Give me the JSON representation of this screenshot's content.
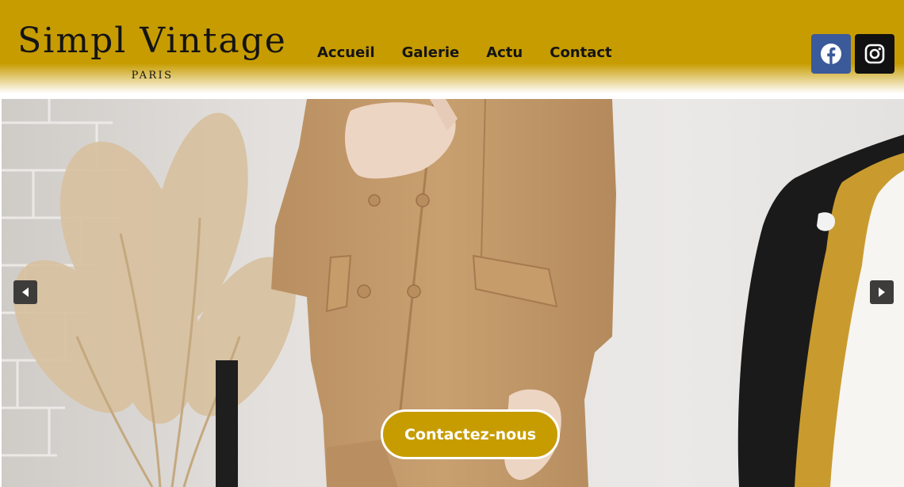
{
  "brand": {
    "title": "Simpl Vintage",
    "subtitle": "PARIS"
  },
  "nav": {
    "items": [
      {
        "label": "Accueil"
      },
      {
        "label": "Galerie"
      },
      {
        "label": "Actu"
      },
      {
        "label": "Contact"
      }
    ]
  },
  "social": {
    "facebook_icon": "facebook-icon",
    "instagram_icon": "instagram-icon"
  },
  "hero": {
    "prev_icon": "caret-left-icon",
    "next_icon": "caret-right-icon",
    "cta_label": "Contactez-nous"
  },
  "colors": {
    "header": "#c79c00",
    "accent": "#c79c00",
    "facebook": "#3b5a9a",
    "instagram": "#111111"
  }
}
